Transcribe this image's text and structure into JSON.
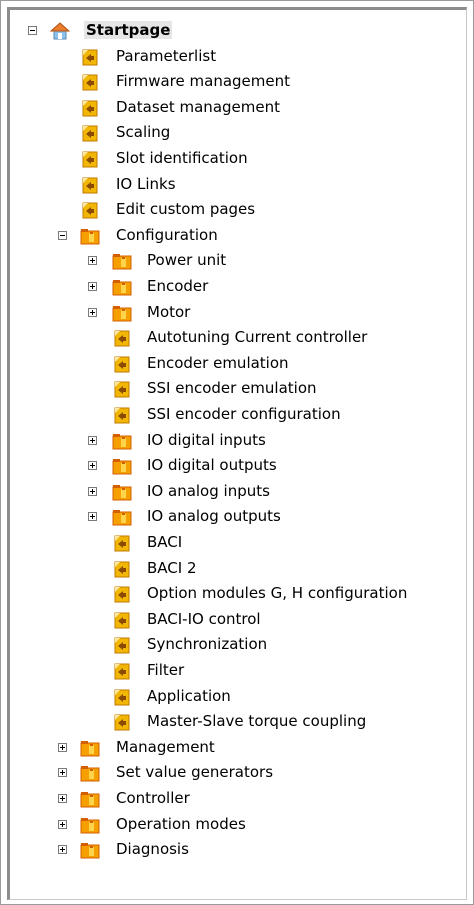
{
  "colors": {
    "page_icon_fill": "#f2b705",
    "page_icon_border": "#c07a00",
    "page_icon_arrow": "#8a4a00",
    "folder_fill": "#f5a000",
    "folder_dark": "#d45f00",
    "folder_accent": "#ffd44d",
    "home_roof": "#e87d2d",
    "home_wall": "#8cc0e8"
  },
  "tree": [
    {
      "label": "Startpage",
      "level": 0,
      "toggle": "minus",
      "icon": "home-icon",
      "bold": true,
      "selected": true
    },
    {
      "label": "Parameterlist",
      "level": 1,
      "toggle": "",
      "icon": "page-icon"
    },
    {
      "label": "Firmware management",
      "level": 1,
      "toggle": "",
      "icon": "page-icon"
    },
    {
      "label": "Dataset management",
      "level": 1,
      "toggle": "",
      "icon": "page-icon"
    },
    {
      "label": "Scaling",
      "level": 1,
      "toggle": "",
      "icon": "page-icon"
    },
    {
      "label": "Slot identification",
      "level": 1,
      "toggle": "",
      "icon": "page-icon"
    },
    {
      "label": "IO Links",
      "level": 1,
      "toggle": "",
      "icon": "page-icon"
    },
    {
      "label": "Edit custom pages",
      "level": 1,
      "toggle": "",
      "icon": "page-icon"
    },
    {
      "label": "Configuration",
      "level": 1,
      "toggle": "minus",
      "icon": "folder-icon"
    },
    {
      "label": "Power unit",
      "level": 2,
      "toggle": "plus",
      "icon": "folder-icon"
    },
    {
      "label": "Encoder",
      "level": 2,
      "toggle": "plus",
      "icon": "folder-icon"
    },
    {
      "label": "Motor",
      "level": 2,
      "toggle": "plus",
      "icon": "folder-icon"
    },
    {
      "label": "Autotuning Current controller",
      "level": 2,
      "toggle": "",
      "icon": "page-icon"
    },
    {
      "label": "Encoder emulation",
      "level": 2,
      "toggle": "",
      "icon": "page-icon"
    },
    {
      "label": "SSI encoder emulation",
      "level": 2,
      "toggle": "",
      "icon": "page-icon"
    },
    {
      "label": "SSI encoder configuration",
      "level": 2,
      "toggle": "",
      "icon": "page-icon"
    },
    {
      "label": "IO digital inputs",
      "level": 2,
      "toggle": "plus",
      "icon": "folder-icon"
    },
    {
      "label": "IO digital outputs",
      "level": 2,
      "toggle": "plus",
      "icon": "folder-icon"
    },
    {
      "label": "IO analog inputs",
      "level": 2,
      "toggle": "plus",
      "icon": "folder-icon"
    },
    {
      "label": "IO analog outputs",
      "level": 2,
      "toggle": "plus",
      "icon": "folder-icon"
    },
    {
      "label": "BACI",
      "level": 2,
      "toggle": "",
      "icon": "page-icon"
    },
    {
      "label": "BACI 2",
      "level": 2,
      "toggle": "",
      "icon": "page-icon"
    },
    {
      "label": "Option modules G, H configuration",
      "level": 2,
      "toggle": "",
      "icon": "page-icon"
    },
    {
      "label": "BACI-IO control",
      "level": 2,
      "toggle": "",
      "icon": "page-icon"
    },
    {
      "label": "Synchronization",
      "level": 2,
      "toggle": "",
      "icon": "page-icon"
    },
    {
      "label": "Filter",
      "level": 2,
      "toggle": "",
      "icon": "page-icon"
    },
    {
      "label": "Application",
      "level": 2,
      "toggle": "",
      "icon": "page-icon"
    },
    {
      "label": "Master-Slave torque coupling",
      "level": 2,
      "toggle": "",
      "icon": "page-icon"
    },
    {
      "label": "Management",
      "level": 1,
      "toggle": "plus",
      "icon": "folder-icon"
    },
    {
      "label": "Set value generators",
      "level": 1,
      "toggle": "plus",
      "icon": "folder-icon"
    },
    {
      "label": "Controller",
      "level": 1,
      "toggle": "plus",
      "icon": "folder-icon"
    },
    {
      "label": "Operation modes",
      "level": 1,
      "toggle": "plus",
      "icon": "folder-icon"
    },
    {
      "label": "Diagnosis",
      "level": 1,
      "toggle": "plus",
      "icon": "folder-icon"
    }
  ]
}
